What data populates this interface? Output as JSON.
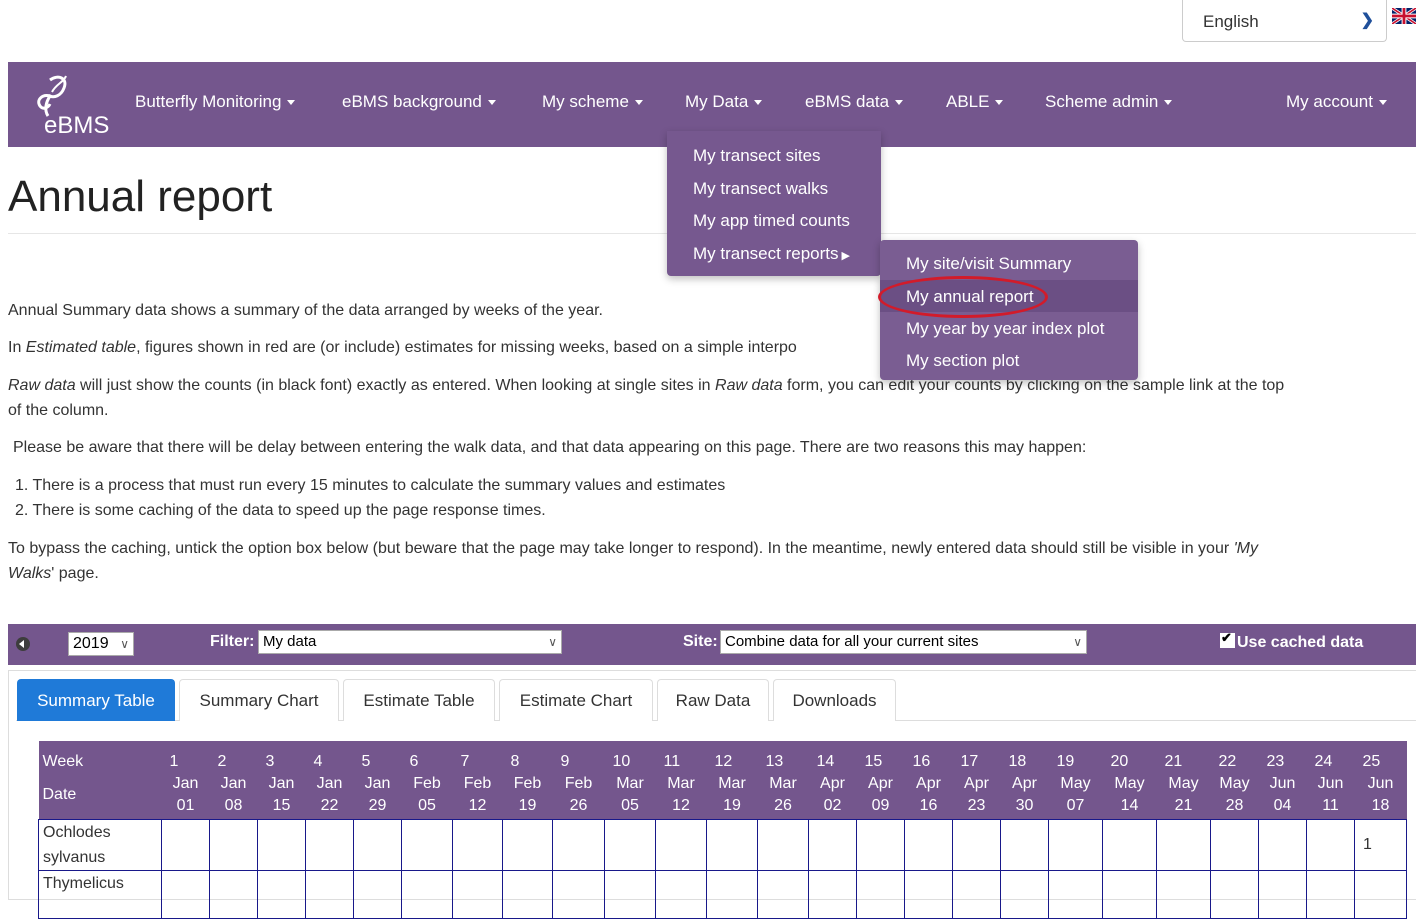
{
  "language": {
    "selected": "English"
  },
  "nav": {
    "brand": "eBMS",
    "items": [
      {
        "label": "Butterfly Monitoring"
      },
      {
        "label": "eBMS background"
      },
      {
        "label": "My scheme"
      },
      {
        "label": "My Data"
      },
      {
        "label": "eBMS data"
      },
      {
        "label": "ABLE"
      },
      {
        "label": "Scheme admin"
      },
      {
        "label": "My account"
      }
    ]
  },
  "my_data_menu": {
    "items": [
      "My transect sites",
      "My transect walks",
      "My app timed counts",
      "My transect reports"
    ]
  },
  "reports_submenu": {
    "items": [
      "My site/visit Summary",
      "My annual report",
      "My year by year index plot",
      "My section plot"
    ]
  },
  "page": {
    "title": "Annual report",
    "para1": "Annual Summary data shows a summary of the data arranged by weeks of the year.",
    "para2a": "In ",
    "para2_em": "Estimated table",
    "para2b": ", figures shown in red are (or include) estimates for missing weeks, based on a simple interpo",
    "para3_em1": "Raw data",
    "para3a": " will just show the counts (in black font) exactly as entered. When looking at single sites in ",
    "para3_em2": "Raw data",
    "para3b": " form, you can edit your counts by clicking on the sample link at the top",
    "para3c": "of the column.",
    "para4": "Please be aware that there will be delay between entering the walk data, and that data appearing on this page. There are two reasons this may happen:",
    "list1": "1. There is a process that must run every 15 minutes to calculate the summary values and estimates",
    "list2": "2. There is some caching of the data to speed up the page response times.",
    "para5a": "To bypass the caching, untick the option box below (but beware that the page may take longer to respond). In the meantime, newly entered data should still be visible in your ",
    "para5_em": "'My",
    "para5_em2": "Walks",
    "para5b": "' page."
  },
  "controls": {
    "year": "2019",
    "filter_label": "Filter:",
    "filter_value": "My data",
    "site_label": "Site:",
    "site_value": "Combine data for all your current sites",
    "cached_label": "Use cached data",
    "cached_checked": true
  },
  "tabs": [
    "Summary Table",
    "Summary Chart",
    "Estimate Table",
    "Estimate Chart",
    "Raw Data",
    "Downloads"
  ],
  "active_tab": "Summary Table",
  "table": {
    "week_label": "Week",
    "date_label": "Date",
    "weeks": [
      "1",
      "2",
      "3",
      "4",
      "5",
      "6",
      "7",
      "8",
      "9",
      "10",
      "11",
      "12",
      "13",
      "14",
      "15",
      "16",
      "17",
      "18",
      "19",
      "20",
      "21",
      "22",
      "23",
      "24",
      "25"
    ],
    "months": [
      "Jan",
      "Jan",
      "Jan",
      "Jan",
      "Jan",
      "Feb",
      "Feb",
      "Feb",
      "Feb",
      "Mar",
      "Mar",
      "Mar",
      "Mar",
      "Apr",
      "Apr",
      "Apr",
      "Apr",
      "Apr",
      "May",
      "May",
      "May",
      "May",
      "Jun",
      "Jun",
      "Jun"
    ],
    "days": [
      "01",
      "08",
      "15",
      "22",
      "29",
      "05",
      "12",
      "19",
      "26",
      "05",
      "12",
      "19",
      "26",
      "02",
      "09",
      "16",
      "23",
      "30",
      "07",
      "14",
      "21",
      "28",
      "04",
      "11",
      "18"
    ],
    "rows": [
      {
        "species": "Ochlodes sylvanus",
        "counts": [
          "",
          "",
          "",
          "",
          "",
          "",
          "",
          "",
          "",
          "",
          "",
          "",
          "",
          "",
          "",
          "",
          "",
          "",
          "",
          "",
          "",
          "",
          "",
          "",
          "1"
        ]
      },
      {
        "species": "Thymelicus",
        "counts": [
          "",
          "",
          "",
          "",
          "",
          "",
          "",
          "",
          "",
          "",
          "",
          "",
          "",
          "",
          "",
          "",
          "",
          "",
          "",
          "",
          "",
          "",
          "",
          "",
          ""
        ]
      }
    ]
  }
}
